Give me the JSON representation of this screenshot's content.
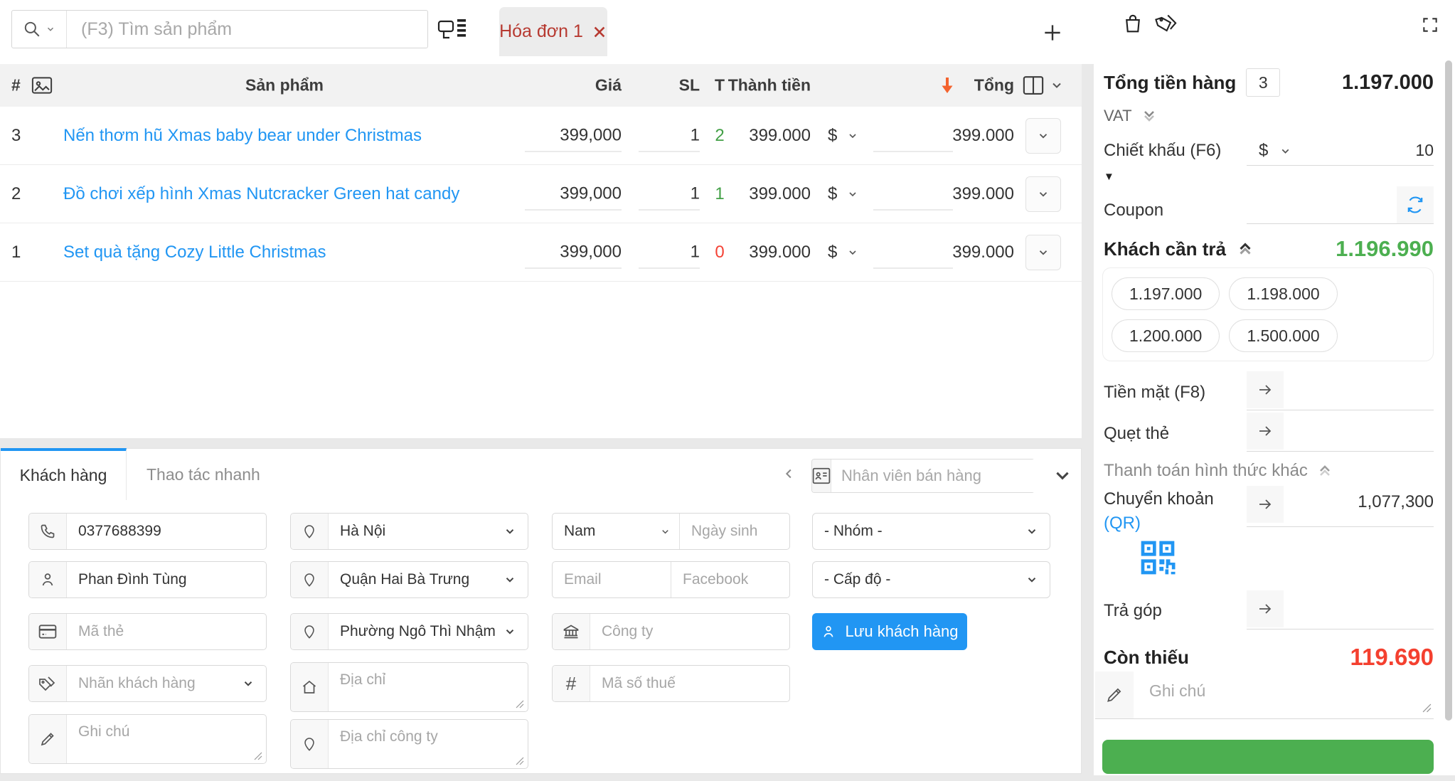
{
  "topbar": {
    "search_placeholder": "(F3) Tìm sản phẩm",
    "tab_label": "Hóa đơn 1"
  },
  "table": {
    "headers": {
      "index": "#",
      "product": "Sản phẩm",
      "price": "Giá",
      "qty": "SL",
      "stock": "T",
      "amount": "Thành tiền",
      "total": "Tổng"
    },
    "rows": [
      {
        "index": "3",
        "name": "Nến thơm hũ Xmas baby bear under Christmas",
        "price": "399,000",
        "qty": "1",
        "stock": "2",
        "stock_color": "#43a047",
        "amount": "399.000",
        "discount_unit": "$",
        "discount_value": "",
        "total": "399.000"
      },
      {
        "index": "2",
        "name": "Đồ chơi xếp hình Xmas Nutcracker Green hat candy",
        "price": "399,000",
        "qty": "1",
        "stock": "1",
        "stock_color": "#43a047",
        "amount": "399.000",
        "discount_unit": "$",
        "discount_value": "",
        "total": "399.000"
      },
      {
        "index": "1",
        "name": "Set quà tặng Cozy Little Christmas",
        "price": "399,000",
        "qty": "1",
        "stock": "0",
        "stock_color": "#f44336",
        "amount": "399.000",
        "discount_unit": "$",
        "discount_value": "",
        "total": "399.000"
      }
    ]
  },
  "customer": {
    "tabs": [
      "Khách hàng",
      "Thao tác nhanh"
    ],
    "staff_placeholder": "Nhân viên bán hàng",
    "form": {
      "phone": {
        "value": "0377688399"
      },
      "name": {
        "value": "Phan Đình Tùng"
      },
      "card_code": {
        "placeholder": "Mã thẻ"
      },
      "customer_label": {
        "placeholder": "Nhãn khách hàng"
      },
      "note": {
        "placeholder": "Ghi chú"
      },
      "city": {
        "value": "Hà Nội"
      },
      "district": {
        "value": "Quận Hai Bà Trưng"
      },
      "ward": {
        "value": "Phường Ngô Thì Nhậm"
      },
      "address": {
        "placeholder": "Địa chỉ"
      },
      "company_address": {
        "placeholder": "Địa chỉ công ty"
      },
      "gender": {
        "value": "Nam"
      },
      "birthday": {
        "placeholder": "Ngày sinh"
      },
      "email": {
        "placeholder": "Email"
      },
      "facebook": {
        "placeholder": "Facebook"
      },
      "company": {
        "placeholder": "Công ty"
      },
      "tax_code": {
        "placeholder": "Mã số thuế"
      },
      "group": {
        "value": "- Nhóm -"
      },
      "level": {
        "value": "- Cấp độ -"
      },
      "save_label": "Lưu khách hàng"
    }
  },
  "sidebar": {
    "total_label": "Tổng tiền hàng",
    "total_count": "3",
    "total_value": "1.197.000",
    "vat_label": "VAT",
    "discount_label": "Chiết khấu (F6)",
    "discount_unit": "$",
    "discount_value": "10",
    "coupon_label": "Coupon",
    "customer_pay_label": "Khách cần trả",
    "customer_pay_value": "1.196.990",
    "suggestions": [
      "1.197.000",
      "1.198.000",
      "1.200.000",
      "1.500.000"
    ],
    "cash_label": "Tiền mặt (F8)",
    "card_label": "Quẹt thẻ",
    "other_methods_label": "Thanh toán hình thức khác",
    "transfer_label": "Chuyển khoản",
    "transfer_qr_label": "(QR)",
    "transfer_value": "1,077,300",
    "installment_label": "Trả góp",
    "remaining_label": "Còn thiếu",
    "remaining_value": "119.690",
    "note_placeholder": "Ghi chú"
  },
  "colors": {
    "accent_blue": "#2196f3",
    "green": "#4caf50",
    "red": "#f44336",
    "orange_sort_arrow": "#f4632e",
    "tab_red": "#b73a31"
  },
  "icons": {
    "search": "magnifier",
    "barcode": "barcode-scanner",
    "close": "x",
    "add": "plus",
    "bag": "shopping-bag",
    "tags": "price-tags",
    "fullscreen": "corner-brackets",
    "image": "picture",
    "columns": "column-layout",
    "sort": "down-arrow",
    "phone": "handset",
    "person": "user",
    "card": "credit-card",
    "tag": "label",
    "pencil": "pencil",
    "pin": "location-pin",
    "home": "house",
    "bank": "bank",
    "hash": "#",
    "staff": "id-card",
    "arrow_right": "arrow-right",
    "refresh": "sync",
    "qr": "qr-code",
    "chevron": "chevron-down",
    "double_chevron": "double-chevron"
  }
}
